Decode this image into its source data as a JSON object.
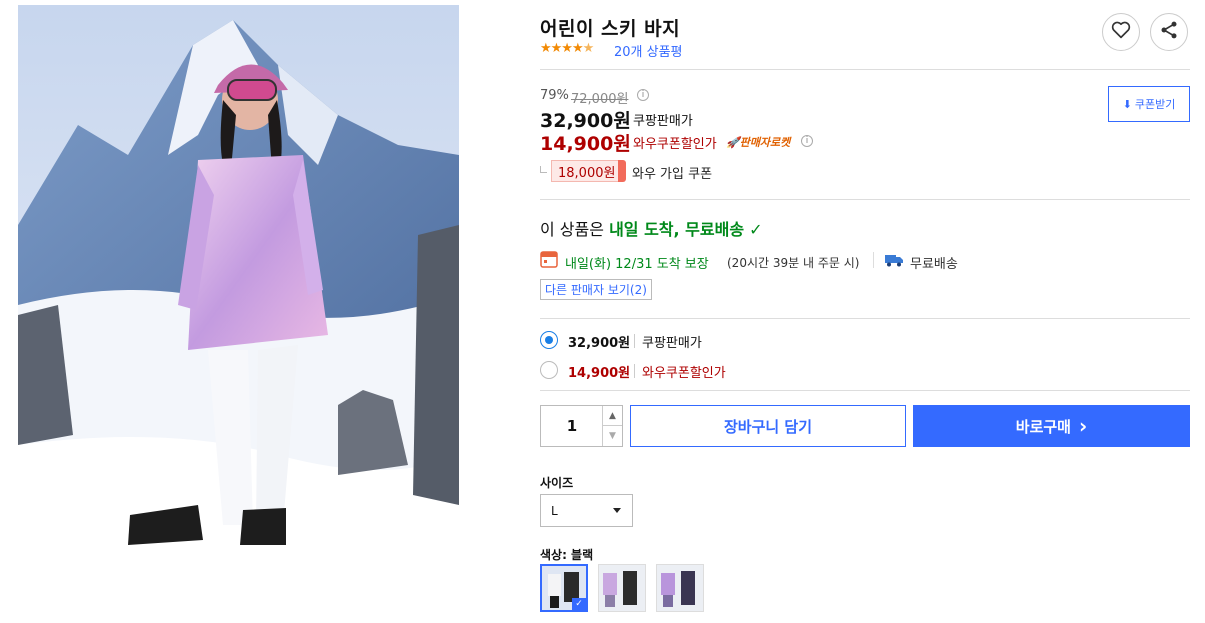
{
  "product": {
    "title": "어린이 스키 바지",
    "stars": "★★★★",
    "half_star": "★",
    "review_count": "20개 상품평"
  },
  "price": {
    "discount_rate": "79%",
    "original": "72,000원",
    "coupang_price": "32,900원",
    "coupang_label": "쿠팡판매가",
    "wow_price": "14,900원",
    "wow_label": "와우쿠폰할인가",
    "rocket_label": "🚀판매자로켓",
    "join_coupon_amount": "18,000원",
    "join_coupon_label": "와우 가입 쿠폰",
    "coupon_download": "쿠폰받기"
  },
  "shipping": {
    "headline_prefix": "이 상품은 ",
    "headline_highlight": "내일 도착, 무료배송",
    "headline_check": "✓",
    "arrival": "내일(화) 12/31 도착 보장",
    "arrival_note": "(20시간 39분 내 주문 시)",
    "free_shipping": "무료배송",
    "other_sellers": "다른 판매자 보기(2)"
  },
  "options": [
    {
      "price": "32,900원",
      "label": "쿠팡판매가",
      "selected": true
    },
    {
      "price": "14,900원",
      "label": "와우쿠폰할인가",
      "selected": false
    }
  ],
  "purchase": {
    "quantity": "1",
    "cart_button": "장바구니 담기",
    "buy_button": "바로구매",
    "buy_chevron": "›"
  },
  "size": {
    "label": "사이즈",
    "value": "L"
  },
  "color": {
    "label": "색상: 블랙",
    "selected_index": 0
  },
  "colors": {
    "brand_blue": "#346aff",
    "price_red": "#ae0000",
    "delivery_green": "#00891a",
    "star_orange": "#f28a05"
  }
}
